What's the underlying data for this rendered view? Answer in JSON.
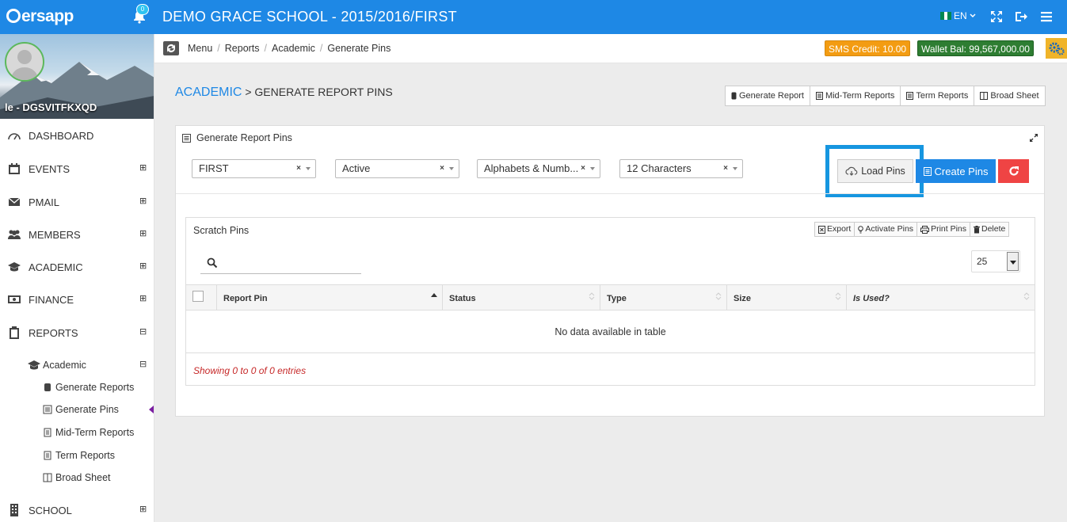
{
  "app": {
    "logo_text": "ersapp",
    "school_title": "DEMO GRACE SCHOOL - 2015/2016/FIRST",
    "notifications": "0",
    "language": "EN"
  },
  "colors": {
    "brand": "#1e88e5",
    "sms": "#f39c12",
    "wallet": "#2e7d32",
    "danger": "#ef4444",
    "highlight": "#1696e0"
  },
  "profile": {
    "name": "le - DGSVITFKXQD"
  },
  "sidebar": {
    "items": [
      {
        "label": "DASHBOARD",
        "icon": "dashboard-icon"
      },
      {
        "label": "EVENTS",
        "icon": "calendar-icon",
        "toggle": "⊞"
      },
      {
        "label": "PMAIL",
        "icon": "envelope-icon",
        "toggle": "⊞"
      },
      {
        "label": "MEMBERS",
        "icon": "users-icon",
        "toggle": "⊞"
      },
      {
        "label": "ACADEMIC",
        "icon": "graduation-cap-icon",
        "toggle": "⊞"
      },
      {
        "label": "FINANCE",
        "icon": "money-icon",
        "toggle": "⊞"
      },
      {
        "label": "REPORTS",
        "icon": "clipboard-icon",
        "toggle": "⊟"
      },
      {
        "label": "SCHOOL",
        "icon": "building-icon",
        "toggle": "⊞"
      }
    ],
    "academic_group": {
      "label": "Academic",
      "toggle": "⊟"
    },
    "sub_items": [
      {
        "label": "Generate Reports"
      },
      {
        "label": "Generate Pins"
      },
      {
        "label": "Mid-Term Reports"
      },
      {
        "label": "Term Reports"
      },
      {
        "label": "Broad Sheet"
      }
    ]
  },
  "breadcrumb": [
    "Menu",
    "Reports",
    "Academic",
    "Generate Pins"
  ],
  "balances": {
    "sms": "SMS Credit: 10.00",
    "wallet": "Wallet Bal: 99,567,000.00"
  },
  "page": {
    "title_section": "ACADEMIC",
    "title_rest": " > GENERATE REPORT PINS"
  },
  "report_buttons": [
    "Generate Report",
    "Mid-Term Reports",
    "Term Reports",
    "Broad Sheet"
  ],
  "panel": {
    "title": "Generate Report Pins",
    "selects": [
      "FIRST",
      "Active",
      "Alphabets & Numb...",
      "12 Characters"
    ],
    "load_label": "Load Pins",
    "create_label": "Create Pins"
  },
  "table": {
    "title": "Scratch Pins",
    "tools": [
      "Export",
      "Activate Pins",
      "Print Pins",
      "Delete"
    ],
    "page_size": "25",
    "columns": [
      "Report Pin",
      "Status",
      "Type",
      "Size",
      "Is Used?"
    ],
    "empty_text": "No data available in table",
    "info": "Showing 0 to 0 of 0 entries"
  }
}
